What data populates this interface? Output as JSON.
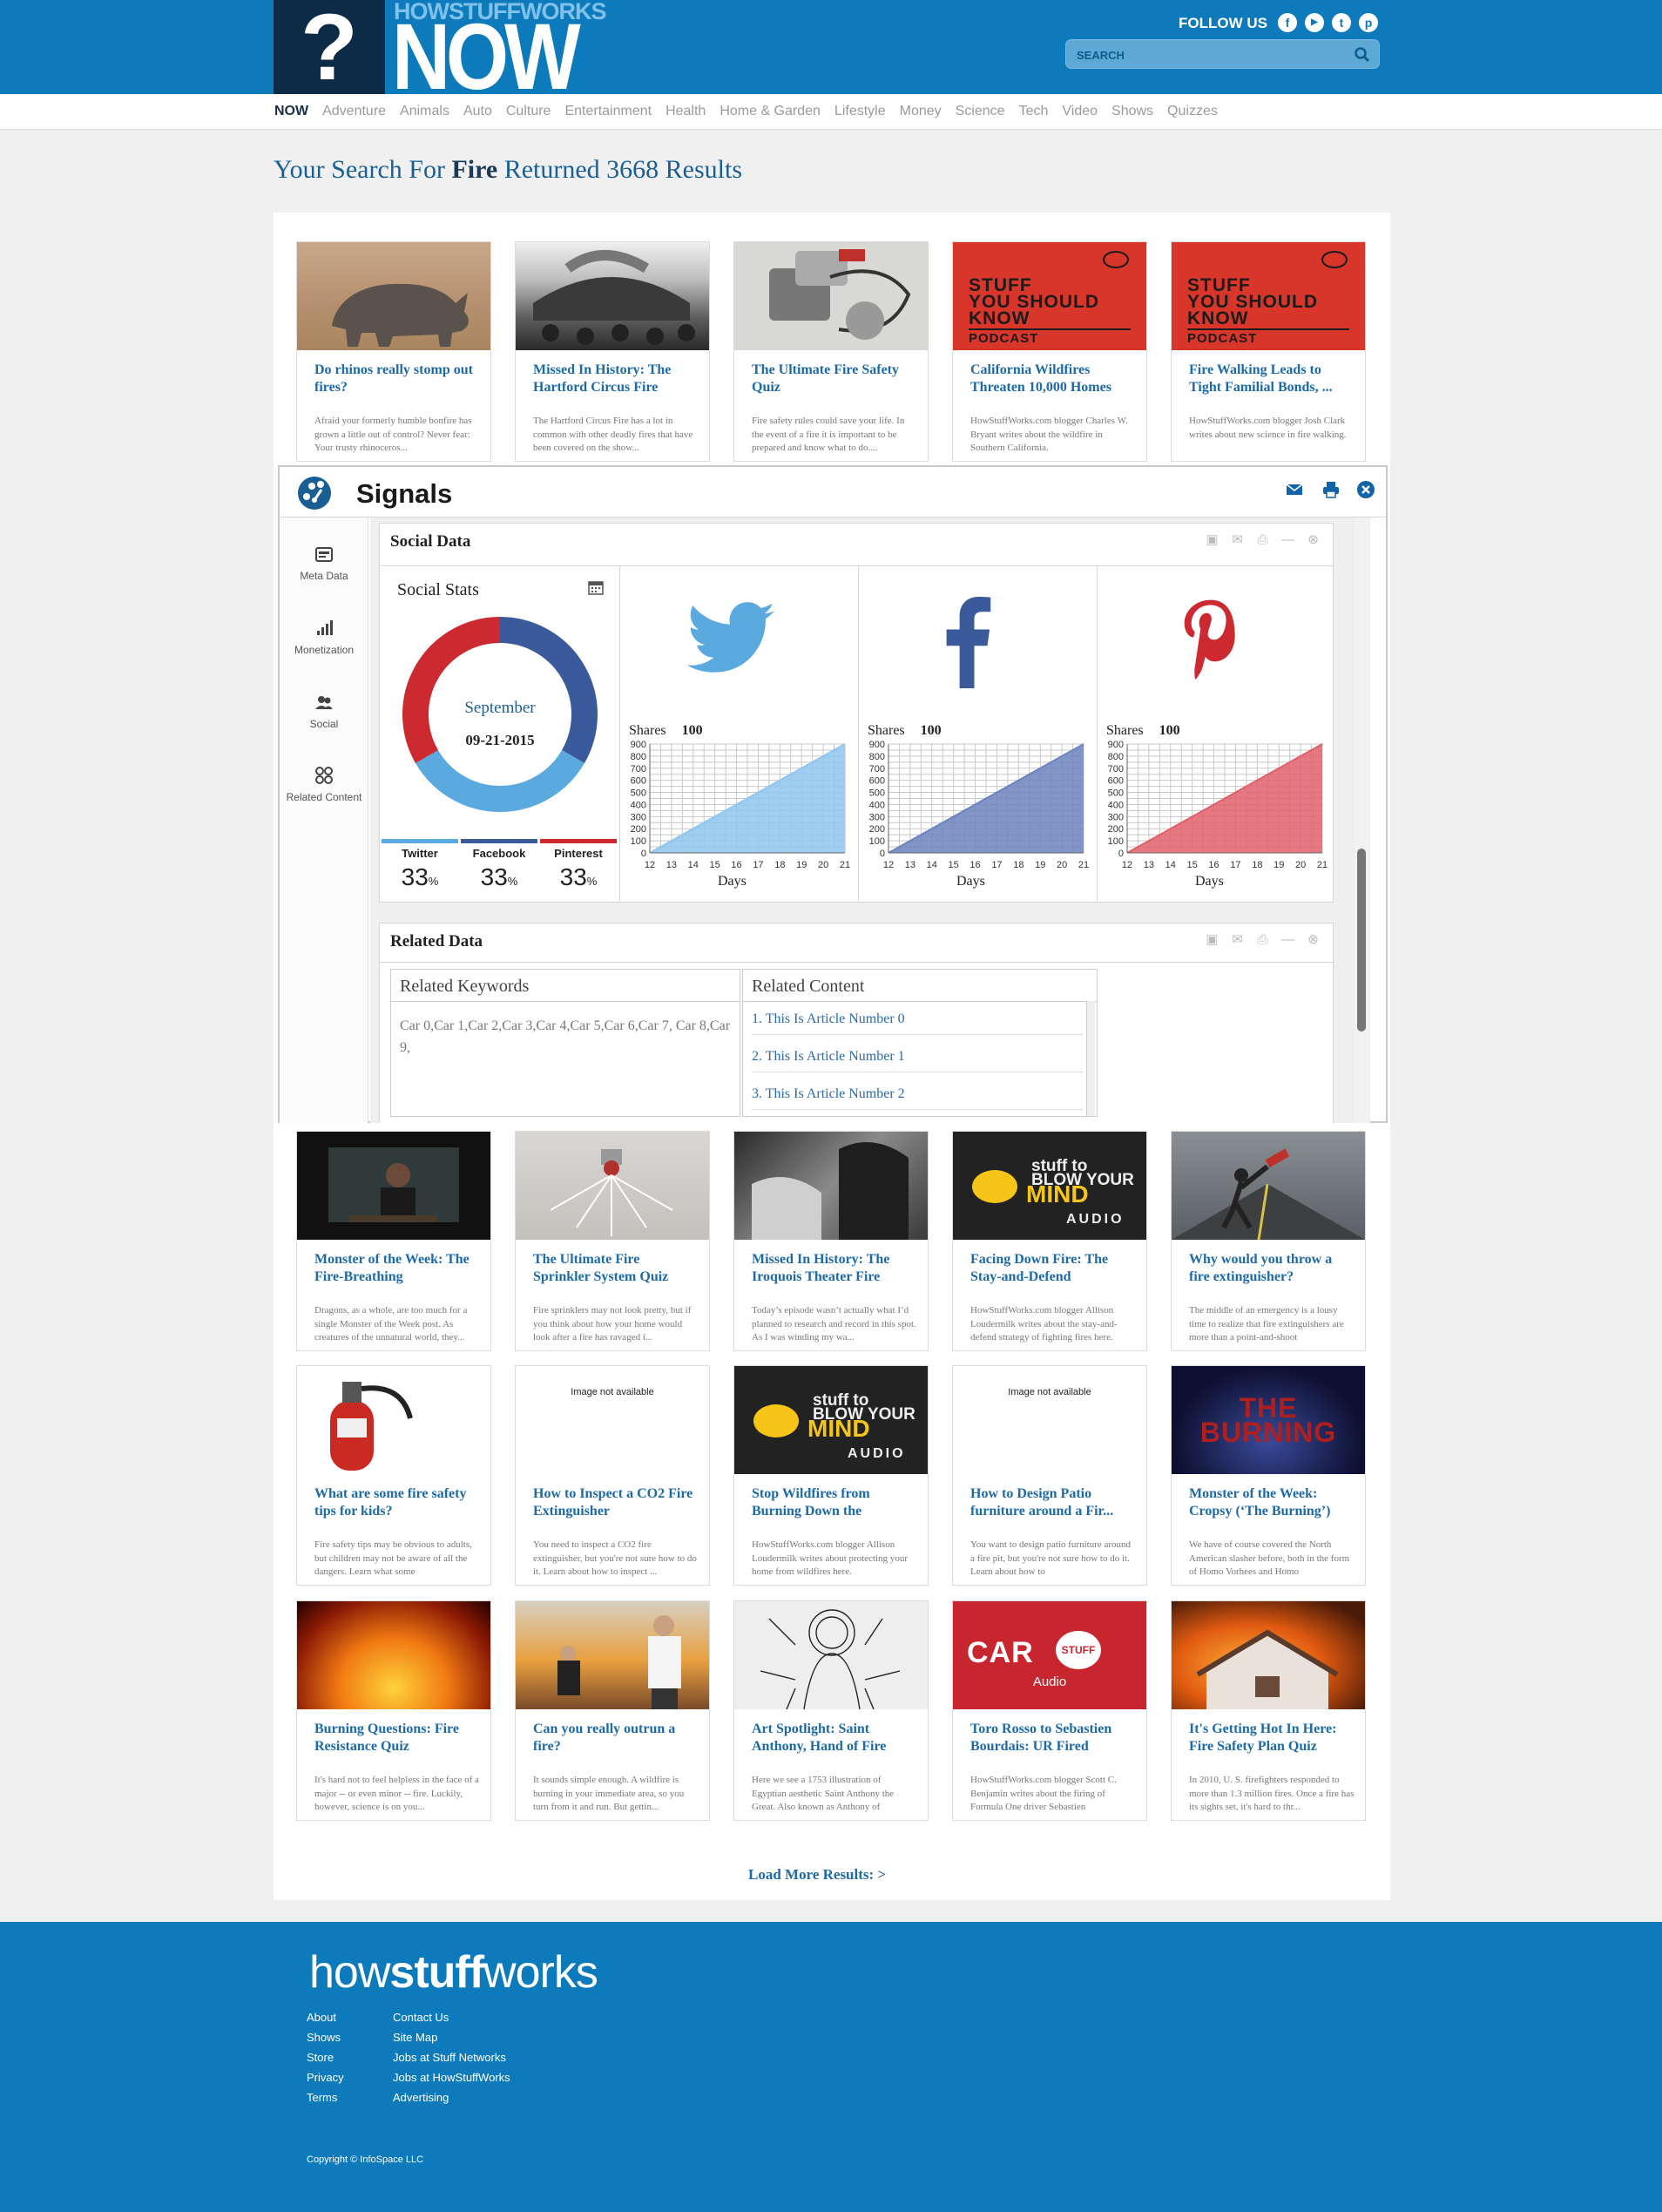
{
  "brand": {
    "q": "?",
    "top": "HOWSTUFFWORKS",
    "now": "NOW"
  },
  "header": {
    "follow": "FOLLOW US",
    "social": [
      "f",
      "▶",
      "t",
      "p"
    ],
    "search_placeholder": "SEARCH"
  },
  "nav": [
    "NOW",
    "Adventure",
    "Animals",
    "Auto",
    "Culture",
    "Entertainment",
    "Health",
    "Home & Garden",
    "Lifestyle",
    "Money",
    "Science",
    "Tech",
    "Video",
    "Shows",
    "Quizzes"
  ],
  "headline": {
    "prefix": "Your Search For ",
    "term": "Fire",
    "suffix": " Returned 3668 Results"
  },
  "cards_top": [
    {
      "title": "Do rhinos really stomp out fires?",
      "excerpt": "Afraid your formerly humble bonfire has grown a little out of control? Never fear: Your trusty rhinoceros..."
    },
    {
      "title": "Missed In History: The Hartford Circus Fire",
      "excerpt": "The Hartford Circus Fire has a lot in common with other deadly fires that have been covered on the show..."
    },
    {
      "title": "The Ultimate Fire Safety Quiz",
      "excerpt": "Fire safety rules could save your life. In the event of a fire it is important to be prepared and know what to do...."
    },
    {
      "title": "California Wildfires Threaten 10,000 Homes",
      "excerpt": "HowStuffWorks.com blogger Charles W. Bryant writes about the wildfire in Southern California."
    },
    {
      "title": "Fire Walking Leads to Tight Familial Bonds, ...",
      "excerpt": "HowStuffWorks.com blogger Josh Clark writes about new science in fire walking."
    }
  ],
  "sysk": {
    "line1": "STUFF",
    "line2": "YOU SHOULD",
    "line3": "KNOW",
    "podcast": "PODCAST"
  },
  "stbym": {
    "a": "stuff to",
    "a2": "BLOW YOUR",
    "b": "MIND",
    "c": "AUDIO"
  },
  "signals": {
    "title": "Signals",
    "sidebar": [
      "Meta Data",
      "Monetization",
      "Social",
      "Related Content"
    ],
    "social_title": "Social Data",
    "stats_title": "Social Stats",
    "donut_month": "September",
    "donut_date": "09-21-2015",
    "legend": [
      {
        "name": "Twitter",
        "value": "33",
        "unit": "%",
        "color": "#5aaae0"
      },
      {
        "name": "Facebook",
        "value": "33",
        "unit": "%",
        "color": "#3a5a9c"
      },
      {
        "name": "Pinterest",
        "value": "33",
        "unit": "%",
        "color": "#cc2a30"
      }
    ],
    "shares_label": "Shares",
    "days_label": "Days",
    "related_title": "Related Data",
    "keywords_title": "Related Keywords",
    "keywords": "Car 0,Car 1,Car 2,Car 3,Car 4,Car 5,Car 6,Car 7, Car 8,Car 9,",
    "content_title": "Related Content",
    "articles": [
      "1. This Is Article Number 0",
      "2. This Is Article Number 1",
      "3. This Is Article Number 2"
    ]
  },
  "chart_data": [
    {
      "type": "pie",
      "title": "Social Stats",
      "categories": [
        "Twitter",
        "Facebook",
        "Pinterest"
      ],
      "values": [
        33,
        33,
        33
      ],
      "colors": [
        "#5aaae0",
        "#3a5a9c",
        "#cc2a30"
      ]
    },
    {
      "type": "area",
      "title": "Shares 100",
      "series": [
        {
          "name": "Twitter",
          "color": "#8ec6ee",
          "x": [
            12,
            21
          ],
          "y": [
            0,
            900
          ]
        }
      ],
      "xlabel": "Days",
      "x_ticks": [
        12,
        13,
        14,
        15,
        16,
        17,
        18,
        19,
        20,
        21
      ],
      "y_ticks": [
        0,
        100,
        200,
        300,
        400,
        500,
        600,
        700,
        800,
        900
      ],
      "ylim": [
        0,
        900
      ]
    },
    {
      "type": "area",
      "title": "Shares 100",
      "series": [
        {
          "name": "Facebook",
          "color": "#6b84bd",
          "x": [
            12,
            21
          ],
          "y": [
            0,
            900
          ]
        }
      ],
      "xlabel": "Days",
      "x_ticks": [
        12,
        13,
        14,
        15,
        16,
        17,
        18,
        19,
        20,
        21
      ],
      "y_ticks": [
        0,
        100,
        200,
        300,
        400,
        500,
        600,
        700,
        800,
        900
      ],
      "ylim": [
        0,
        900
      ]
    },
    {
      "type": "area",
      "title": "Shares 100",
      "series": [
        {
          "name": "Pinterest",
          "color": "#e0606a",
          "x": [
            12,
            21
          ],
          "y": [
            0,
            900
          ]
        }
      ],
      "xlabel": "Days",
      "x_ticks": [
        12,
        13,
        14,
        15,
        16,
        17,
        18,
        19,
        20,
        21
      ],
      "y_ticks": [
        0,
        100,
        200,
        300,
        400,
        500,
        600,
        700,
        800,
        900
      ],
      "ylim": [
        0,
        900
      ]
    }
  ],
  "cards_rows": [
    [
      {
        "title": "Monster of the Week: The Fire-Breathing",
        "excerpt": "Dragons, as a whole, are too much for a single Monster of the Week post. As creatures of the unnatural world, they..."
      },
      {
        "title": "The Ultimate Fire Sprinkler System Quiz",
        "excerpt": "Fire sprinklers may not look pretty, but if you think about how your home would look after a fire has ravaged i..."
      },
      {
        "title": "Missed In History: The Iroquois Theater Fire",
        "excerpt": "Today’s episode wasn’t actually what I’d planned to research and record in this spot. As I was winding my wa..."
      },
      {
        "title": "Facing Down Fire: The Stay-and-Defend",
        "excerpt": "HowStuffWorks.com blogger Allison Loudermilk writes about the stay-and-defend strategy of fighting fires here."
      },
      {
        "title": "Why would you throw a fire extinguisher?",
        "excerpt": "The middle of an emergency is a lousy time to realize that fire extinguishers are more than a point-and-shoot"
      }
    ],
    [
      {
        "title": "What are some fire safety tips for kids?",
        "excerpt": "Fire safety tips may be obvious to adults, but children may not be aware of all the dangers. Learn what some"
      },
      {
        "title": "How to Inspect a CO2 Fire Extinguisher",
        "excerpt": "You need to inspect a CO2 fire extinguisher, but you're not sure how to do it. Learn about how to inspect ..."
      },
      {
        "title": "Stop Wildfires from Burning Down the",
        "excerpt": "HowStuffWorks.com blogger Allison Loudermilk writes about protecting your home from wildfires here."
      },
      {
        "title": "How to Design Patio furniture around a Fir...",
        "excerpt": "You want to design patio furniture around a fire pit, but you're not sure how to do it. Learn about how to"
      },
      {
        "title": "Monster of the Week: Cropsy (‘The Burning’)",
        "excerpt": "We have of course covered the North American slasher before, both in the form of Homo Vorhees and Homo"
      }
    ],
    [
      {
        "title": "Burning Questions: Fire Resistance Quiz",
        "excerpt": "It's hard not to feel helpless in the face of a major -- or even minor -- fire. Luckily, however, science is on you..."
      },
      {
        "title": "Can you really outrun a fire?",
        "excerpt": "It sounds simple enough. A wildfire is burning in your immediate area, so you turn from it and run. But gettin..."
      },
      {
        "title": "Art Spotlight: Saint Anthony, Hand of Fire",
        "excerpt": "Here we see a 1753 illustration of Egyptian aesthetic Saint Anthony the Great. Also known as Anthony of"
      },
      {
        "title": "Toro Rosso to Sebastien Bourdais: UR Fired",
        "excerpt": "HowStuffWorks.com blogger Scott C. Benjamin writes about the firing of Formula One driver Sebastien"
      },
      {
        "title": "It's Getting Hot In Here: Fire Safety Plan Quiz",
        "excerpt": "In 2010, U. S. firefighters responded to more than 1.3 million fires. Once a fire has its sights set, it's hard to thr..."
      }
    ]
  ],
  "image_not_available": "Image not available",
  "car_stuff": {
    "car": "CAR",
    "stuff": "STUFF",
    "audio": "Audio"
  },
  "burning": "THE BURNING",
  "load_more": "Load More Results: >",
  "footer": {
    "logo_a": "how",
    "logo_b": "stuff",
    "logo_c": "works",
    "col1": [
      "About",
      "Shows",
      "Store",
      "Privacy",
      "Terms"
    ],
    "col2": [
      "Contact Us",
      "Site Map",
      "Jobs at Stuff Networks",
      "Jobs at HowStuffWorks",
      "Advertising"
    ],
    "copyright": "Copyright © InfoSpace LLC"
  }
}
